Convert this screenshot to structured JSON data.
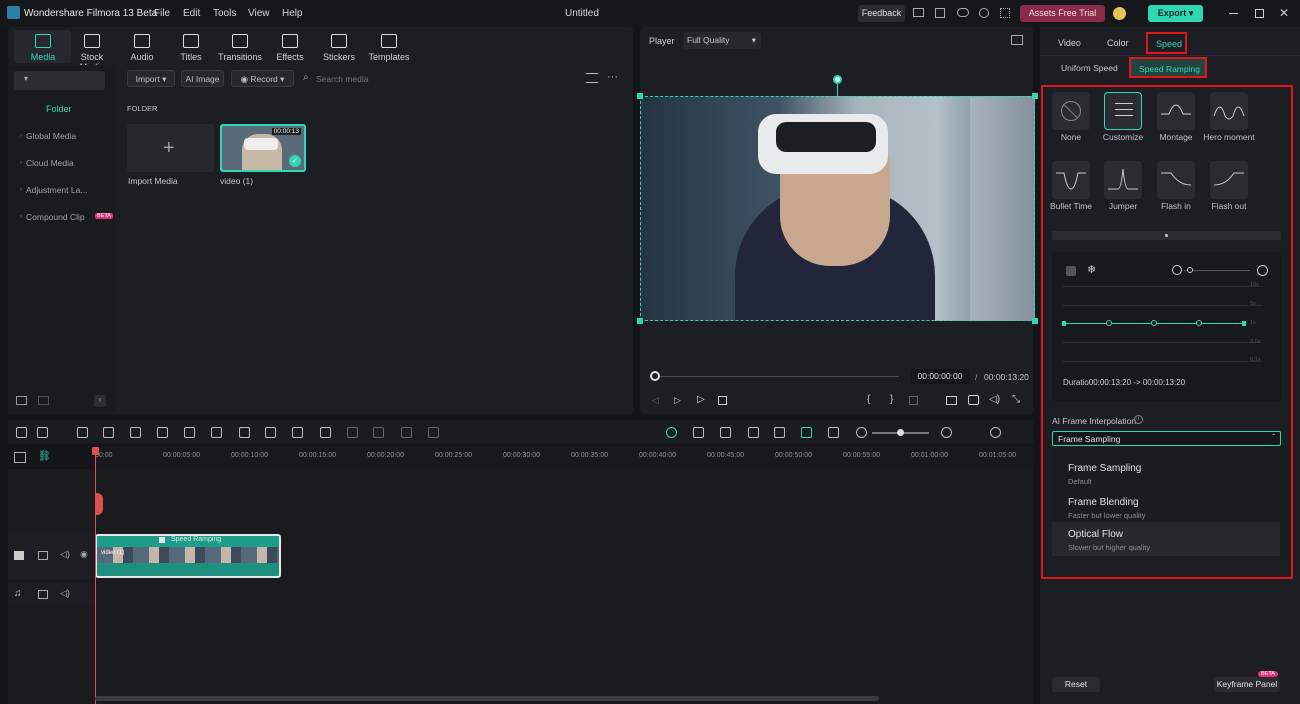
{
  "app": {
    "title": "Wondershare Filmora 13 Beta",
    "document_title": "Untitled"
  },
  "menu": [
    "File",
    "Edit",
    "Tools",
    "View",
    "Help"
  ],
  "topbar": {
    "feedback": "Feedback",
    "assets": "Assets Free Trial",
    "export": "Export"
  },
  "toolbar": [
    {
      "label": "Media",
      "icon": "media-icon",
      "active": true
    },
    {
      "label": "Stock Media",
      "icon": "stock-media-icon"
    },
    {
      "label": "Audio",
      "icon": "audio-icon"
    },
    {
      "label": "Titles",
      "icon": "titles-icon"
    },
    {
      "label": "Transitions",
      "icon": "transitions-icon"
    },
    {
      "label": "Effects",
      "icon": "effects-icon"
    },
    {
      "label": "Stickers",
      "icon": "stickers-icon"
    },
    {
      "label": "Templates",
      "icon": "templates-icon"
    }
  ],
  "media": {
    "folder_label": "Folder",
    "side_items": [
      "Global Media",
      "Cloud Media",
      "Adjustment La...",
      "Compound Clip"
    ],
    "compound_badge": "BETA",
    "import": "Import",
    "ai_image": "AI Image",
    "record": "Record",
    "search_placeholder": "Search media",
    "section": "FOLDER",
    "items": [
      {
        "label": "Import Media"
      },
      {
        "label": "video (1)",
        "duration": "00:00:13"
      }
    ]
  },
  "player": {
    "label": "Player",
    "quality": "Full Quality",
    "current": "00:00:00:00",
    "total": "00:00:13:20",
    "separator": "/"
  },
  "right": {
    "tabs": [
      "Video",
      "Color",
      "Speed"
    ],
    "subtabs": [
      "Uniform Speed",
      "Speed Ramping"
    ],
    "presets": [
      "None",
      "Customize",
      "Montage",
      "Hero moment",
      "Bullet Time",
      "Jumper",
      "Flash in",
      "Flash out"
    ],
    "scale": [
      "10x",
      "5x",
      "1x",
      "0.5x",
      "0.1x"
    ],
    "duration": "Duratio00:00:13:20 -> 00:00:13:20",
    "ai_label": "AI Frame Interpolation",
    "dropdown_value": "Frame Sampling",
    "options": [
      {
        "title": "Frame Sampling",
        "sub": "Default"
      },
      {
        "title": "Frame Blending",
        "sub": "Faster but lower quality"
      },
      {
        "title": "Optical Flow",
        "sub": "Slower but higher quality"
      }
    ],
    "reset": "Reset",
    "keyframe": "Keyframe Panel",
    "beta": "BETA"
  },
  "timeline": {
    "ticks": [
      "00:00",
      "00:00:05:00",
      "00:00:10:00",
      "00:00:15:00",
      "00:00:20:00",
      "00:00:25:00",
      "00:00:30:00",
      "00:00:35:00",
      "00:00:40:00",
      "00:00:45:00",
      "00:00:50:00",
      "00:00:55:00",
      "00:01:00:00",
      "00:01:05:00"
    ],
    "clip_label": "Speed Ramping",
    "clip_name": "video (1)"
  },
  "colors": {
    "accent": "#2fd8b5",
    "highlight": "#e0161f",
    "bg": "#1d1e23"
  }
}
